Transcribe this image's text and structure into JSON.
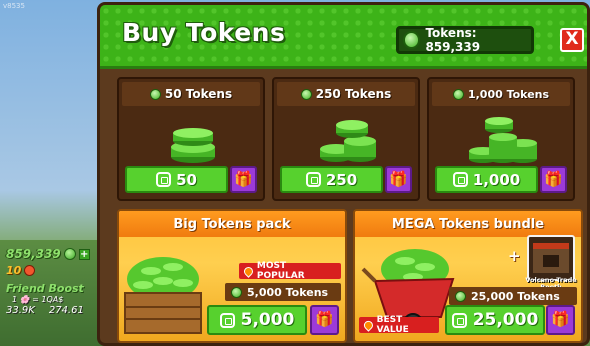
{
  "version": "v8535",
  "hud": {
    "tokens": "859,339",
    "coins": "10",
    "boost_title": "Friend Boost",
    "boost_rate": "1 🌸 = 1QA$",
    "stat_left": "33.9K",
    "stat_right": "274.61"
  },
  "panel": {
    "title": "Buy Tokens",
    "balance": "Tokens: 859,339",
    "close_label": "X"
  },
  "cards": [
    {
      "title": "50 Tokens",
      "price": "50"
    },
    {
      "title": "250 Tokens",
      "price": "250"
    },
    {
      "title": "1,000 Tokens",
      "price": "1,000"
    }
  ],
  "bundles": [
    {
      "title": "Big Tokens pack",
      "badge": "MOST POPULAR",
      "amount": "5,000 Tokens",
      "price": "5,000"
    },
    {
      "title": "MEGA Tokens bundle",
      "badge": "BEST VALUE",
      "amount": "25,000 Tokens",
      "price": "25,000",
      "extra": "Volcano Trade Booth"
    }
  ],
  "colors": {
    "header_green": "#3db318",
    "price_green": "#57d12e",
    "gift_purple": "#9c3ad8",
    "close_red": "#e02b1c",
    "panel_brown": "#5c3a1e",
    "bundle_gold": "#ffc23a"
  },
  "icons": {
    "token": "token-gem-icon",
    "robux": "robux-icon",
    "gift": "gift-icon",
    "close": "close-icon"
  }
}
